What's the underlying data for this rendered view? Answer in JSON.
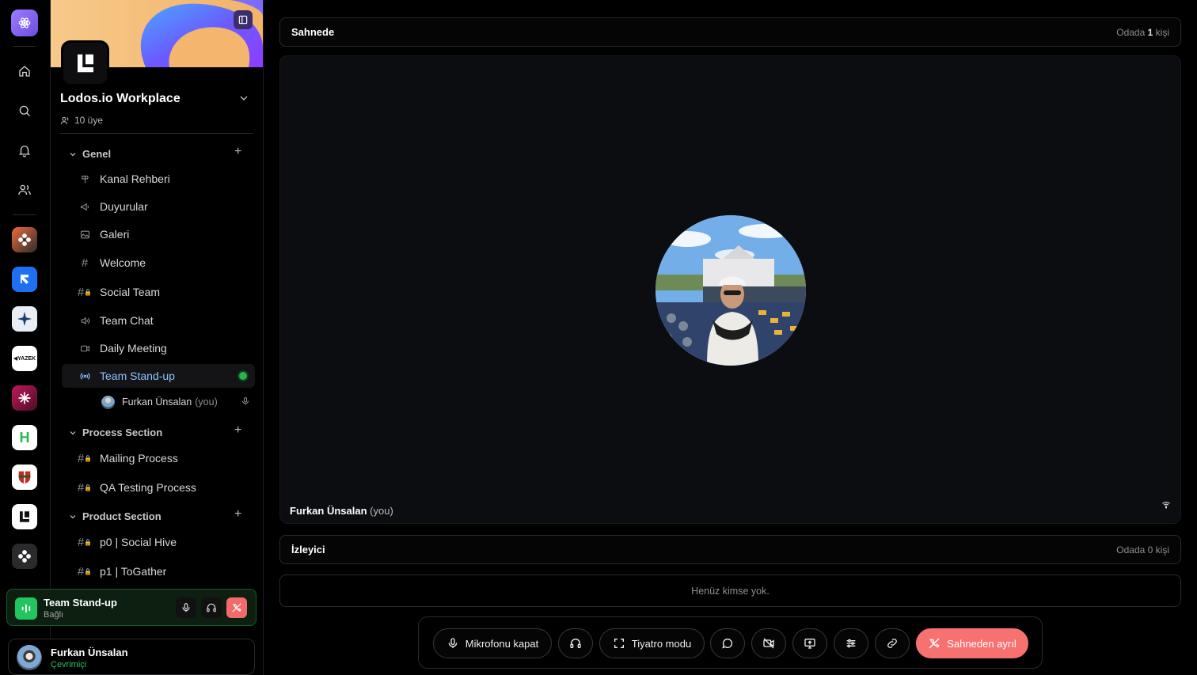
{
  "workspace": {
    "name": "Lodos.io Workplace",
    "members": "10 üye"
  },
  "sections": [
    {
      "title": "Genel",
      "channels": [
        {
          "label": "Kanal Rehberi",
          "icon": "signpost-icon"
        },
        {
          "label": "Duyurular",
          "icon": "megaphone-icon"
        },
        {
          "label": "Galeri",
          "icon": "image-icon"
        },
        {
          "label": "Welcome",
          "icon": "hash-icon"
        },
        {
          "label": "Social Team",
          "icon": "hash-lock-icon"
        },
        {
          "label": "Team Chat",
          "icon": "speaker-icon"
        },
        {
          "label": "Daily Meeting",
          "icon": "video-icon"
        },
        {
          "label": "Team Stand-up",
          "icon": "stage-icon",
          "active": true
        }
      ],
      "stage_member": {
        "name": "Furkan Ünsalan",
        "suffix": "(you)"
      }
    },
    {
      "title": "Process Section",
      "channels": [
        {
          "label": "Mailing Process",
          "icon": "hash-lock-icon"
        },
        {
          "label": "QA Testing Process",
          "icon": "hash-lock-icon"
        }
      ]
    },
    {
      "title": "Product Section",
      "channels": [
        {
          "label": "p0 | Social Hive",
          "icon": "hash-lock-icon"
        },
        {
          "label": "p1 | ToGather",
          "icon": "hash-lock-icon"
        }
      ]
    }
  ],
  "voice_panel": {
    "channel": "Team Stand-up",
    "status": "Bağlı"
  },
  "user_panel": {
    "name": "Furkan Ünsalan",
    "status": "Çevrimiçi"
  },
  "stage_bar": {
    "title": "Sahnede",
    "count_prefix": "Odada",
    "count": "1",
    "count_suffix": "kişi"
  },
  "stage": {
    "speaker_name": "Furkan Ünsalan",
    "speaker_suffix": "(you)"
  },
  "audience_bar": {
    "title": "İzleyici",
    "count_text": "Odada 0 kişi"
  },
  "audience_empty": "Henüz kimse yok.",
  "controls": {
    "mic_label": "Mikrofonu kapat",
    "theater_label": "Tiyatro modu",
    "leave_label": "Sahneden ayrıl"
  },
  "colors": {
    "accent_blue": "#8cc4ff",
    "online_green": "#22c55e",
    "danger_red": "#f87171"
  }
}
